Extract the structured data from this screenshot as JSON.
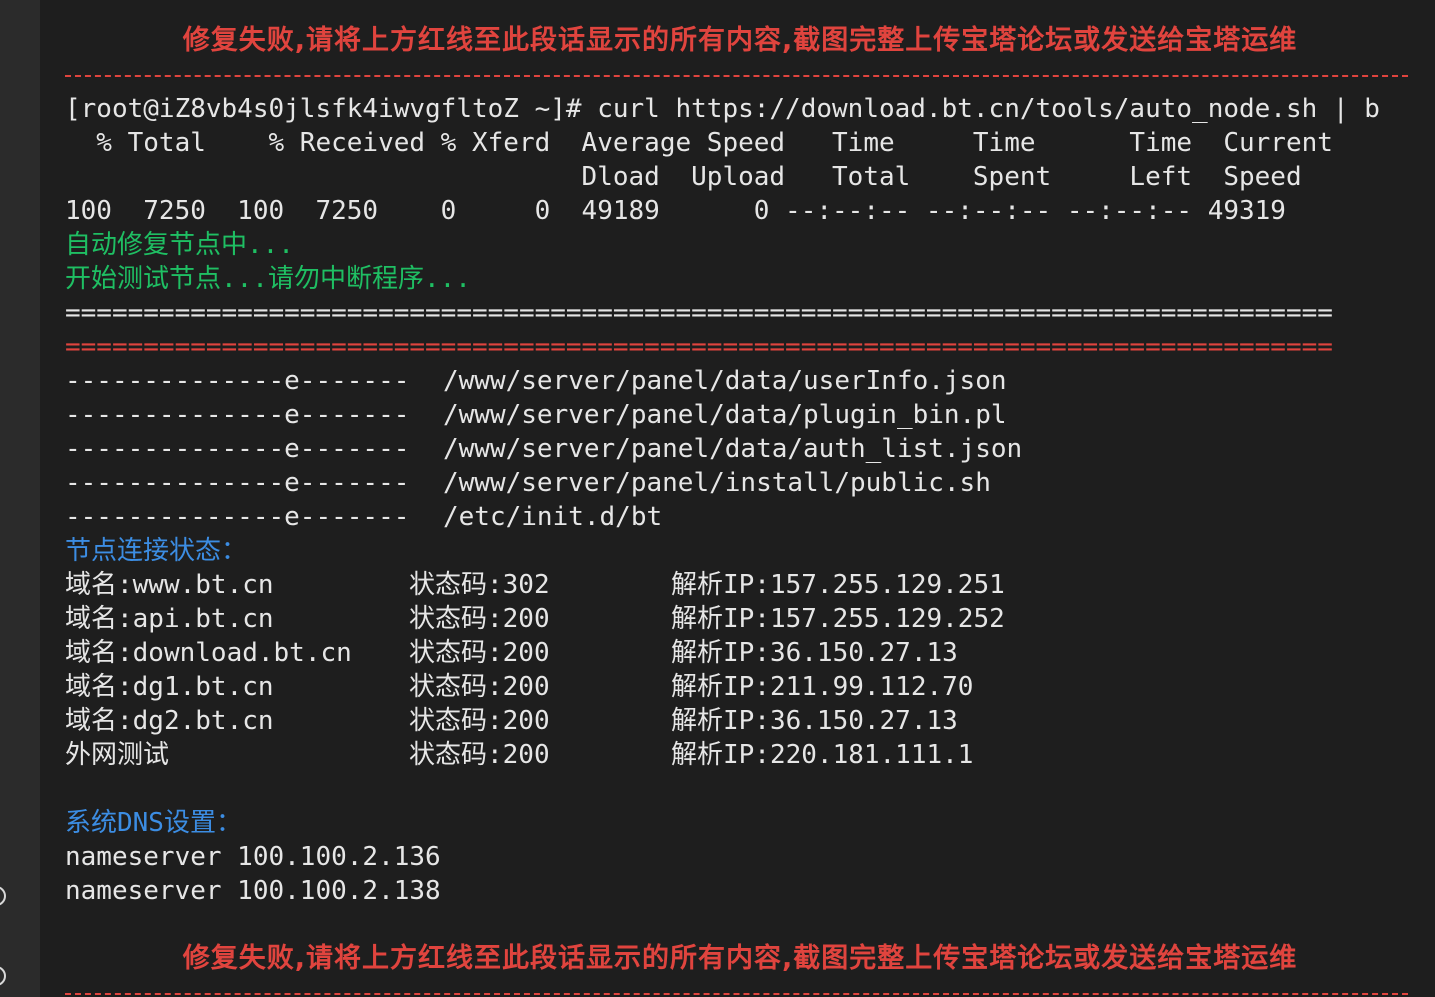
{
  "banner": "修复失败,请将上方红线至此段话显示的所有内容,截图完整上传宝塔论坛或发送给宝塔运维",
  "command_line": "[root@iZ8vb4s0jlsfk4iwvgfltoZ ~]# curl https://download.bt.cn/tools/auto_node.sh | b",
  "curl_header_1": "  % Total    % Received % Xferd  Average Speed   Time     Time      Time  Current",
  "curl_header_2": "                                 Dload  Upload   Total    Spent     Left  Speed",
  "curl_progress": "100  7250  100  7250    0     0  49189      0 --:--:-- --:--:-- --:--:-- 49319",
  "status": {
    "auto_repair": "自动修复节点中...",
    "start_test": "开始测试节点...请勿中断程序..."
  },
  "separator_white": "=================================================================================",
  "separator_red": "=================================================================================",
  "file_checks": [
    {
      "flags": "--------------e-------",
      "path": "/www/server/panel/data/userInfo.json"
    },
    {
      "flags": "--------------e-------",
      "path": "/www/server/panel/data/plugin_bin.pl"
    },
    {
      "flags": "--------------e-------",
      "path": "/www/server/panel/data/auth_list.json"
    },
    {
      "flags": "--------------e-------",
      "path": "/www/server/panel/install/public.sh"
    },
    {
      "flags": "--------------e-------",
      "path": "/etc/init.d/bt"
    }
  ],
  "node_status_title": "节点连接状态：",
  "nodes": [
    {
      "domain": "域名:www.bt.cn",
      "code": "状态码:302",
      "ip": "解析IP:157.255.129.251"
    },
    {
      "domain": "域名:api.bt.cn",
      "code": "状态码:200",
      "ip": "解析IP:157.255.129.252"
    },
    {
      "domain": "域名:download.bt.cn",
      "code": "状态码:200",
      "ip": "解析IP:36.150.27.13"
    },
    {
      "domain": "域名:dg1.bt.cn",
      "code": "状态码:200",
      "ip": "解析IP:211.99.112.70"
    },
    {
      "domain": "域名:dg2.bt.cn",
      "code": "状态码:200",
      "ip": "解析IP:36.150.27.13"
    },
    {
      "domain": "外网测试",
      "code": "状态码:200",
      "ip": "解析IP:220.181.111.1"
    }
  ],
  "dns_title": "系统DNS设置：",
  "nameservers": [
    "nameserver 100.100.2.136",
    "nameserver 100.100.2.138"
  ],
  "colors": {
    "background": "#1e1e1e",
    "text": "#e6e6e6",
    "red": "#e0443e",
    "green": "#1fbf63",
    "blue": "#3c8de3"
  }
}
